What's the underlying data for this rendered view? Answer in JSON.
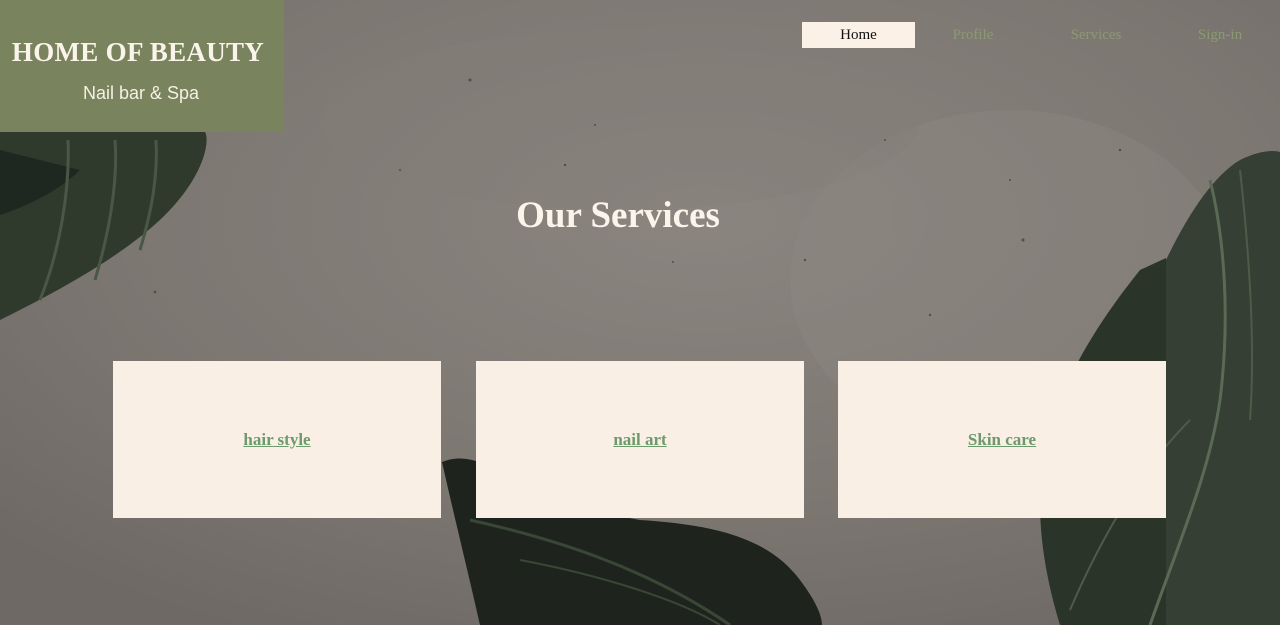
{
  "brand": {
    "title": "HOME OF BEAUTY",
    "subtitle": "Nail bar & Spa"
  },
  "nav": {
    "items": [
      {
        "label": "Home",
        "active": true
      },
      {
        "label": "Profile",
        "active": false
      },
      {
        "label": "Services",
        "active": false
      },
      {
        "label": "Sign-in",
        "active": false
      }
    ]
  },
  "main": {
    "title": "Our Services",
    "services": [
      {
        "label": "hair style"
      },
      {
        "label": "nail art"
      },
      {
        "label": "Skin care"
      }
    ]
  },
  "colors": {
    "logo_background": "#79845f",
    "nav_active_background": "#fbf1e6",
    "nav_link": "#8b9a73",
    "card_background": "#f9efe4",
    "card_link": "#6c9a6c",
    "page_background": "#807b76"
  }
}
